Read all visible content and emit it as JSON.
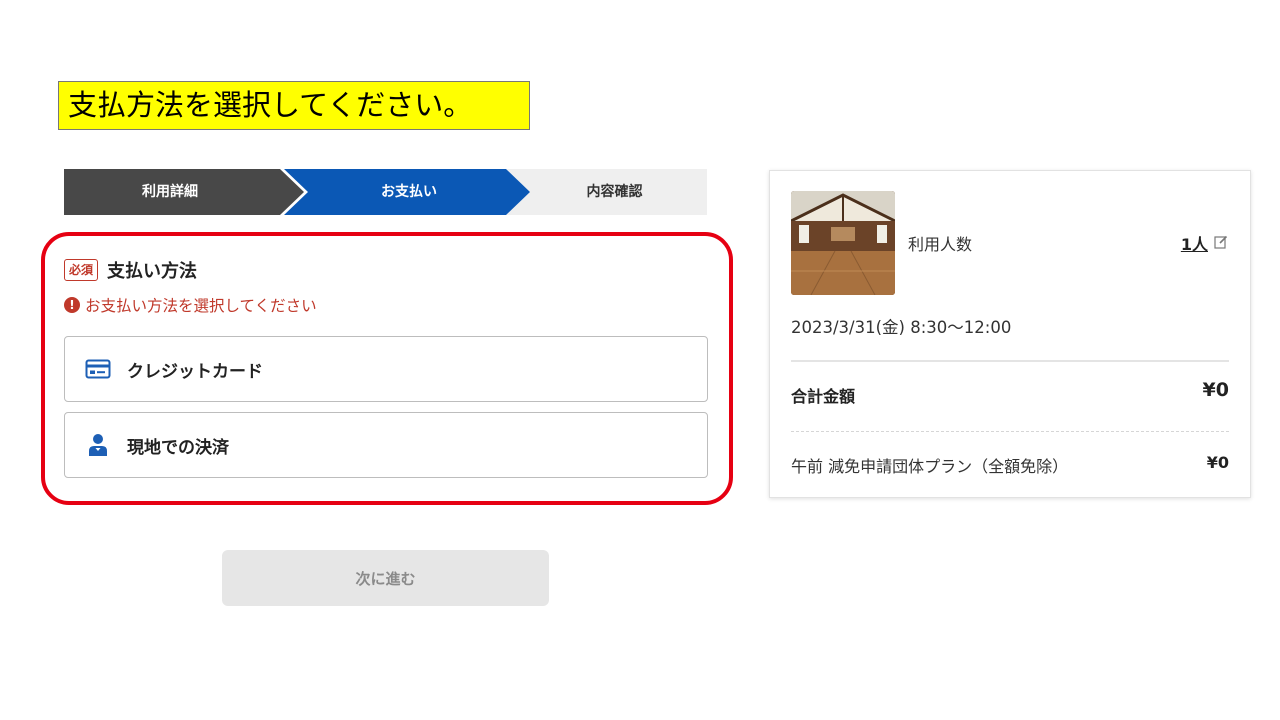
{
  "banner": {
    "text": "支払方法を選択してください。"
  },
  "steps": [
    {
      "label": "利用詳細",
      "state": "done"
    },
    {
      "label": "お支払い",
      "state": "current"
    },
    {
      "label": "内容確認",
      "state": "pending"
    }
  ],
  "payment": {
    "required_badge": "必須",
    "title": "支払い方法",
    "error_icon": "!",
    "error": "お支払い方法を選択してください",
    "options": [
      {
        "label": "クレジットカード",
        "icon": "credit-card-icon"
      },
      {
        "label": "現地での決済",
        "icon": "person-icon"
      }
    ]
  },
  "next_button": {
    "label": "次に進む",
    "enabled": false
  },
  "summary": {
    "usage_label": "利用人数",
    "usage_count": "1人",
    "datetime": "2023/3/31(金) 8:30〜12:00",
    "total_label": "合計金額",
    "total_value": "¥0",
    "plan_label": "午前 減免申請団体プラン（全額免除）",
    "plan_value": "¥0"
  },
  "colors": {
    "step_done": "#484848",
    "step_current": "#0b58b5",
    "step_pending": "#efefef",
    "error": "#c0392b",
    "highlight": "#e60012",
    "banner": "#ffff00",
    "icon_blue": "#1d5fb5"
  }
}
